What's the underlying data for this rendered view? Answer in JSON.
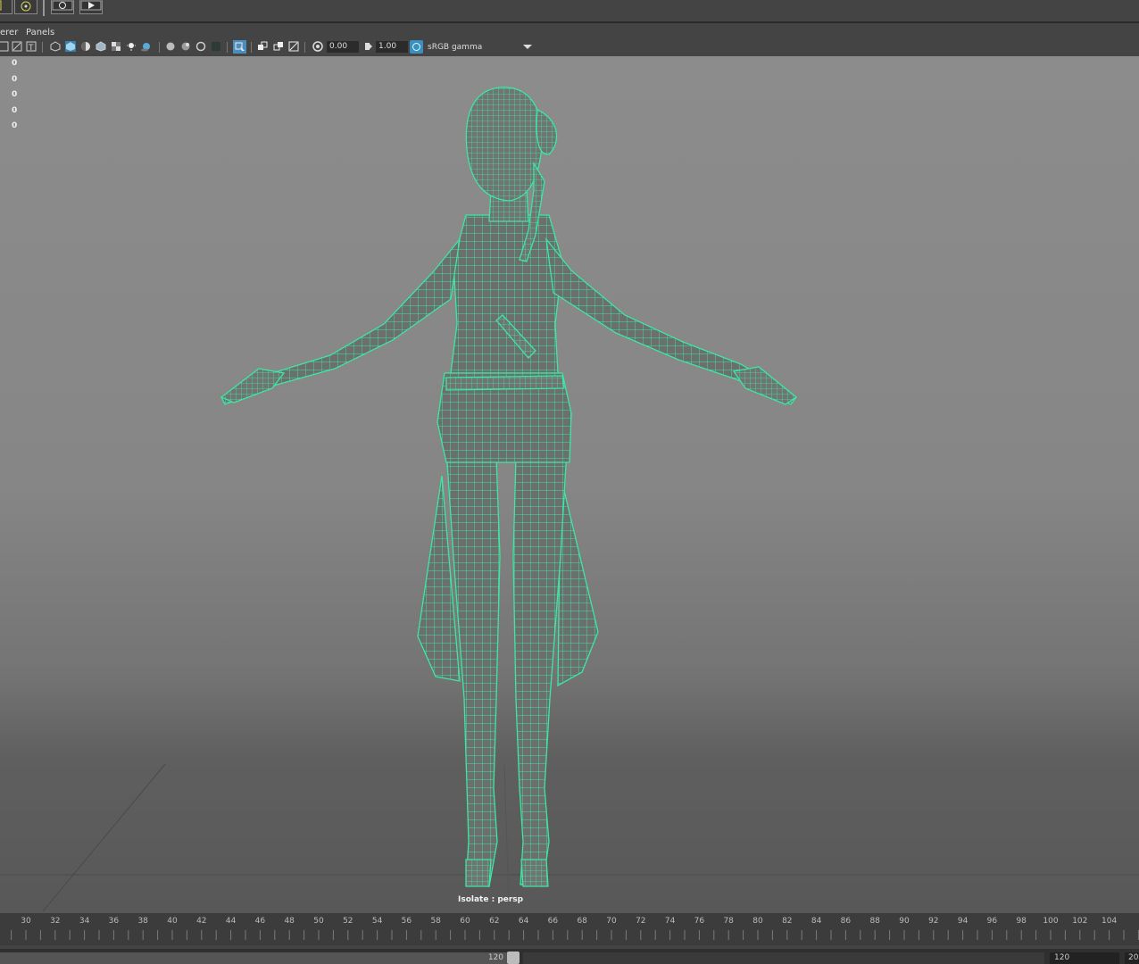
{
  "menu": {
    "renderer_partial": "erer",
    "panels": "Panels"
  },
  "toolbar": {
    "exposure_value": "0.00",
    "gamma_value": "1.00",
    "color_space": "sRGB gamma"
  },
  "hud": {
    "lines": [
      "0",
      "0",
      "0",
      "0",
      "0"
    ]
  },
  "viewport": {
    "isolate_label": "Isolate : persp",
    "wireframe_color": "#3ee6a4",
    "mesh_fill_color": "#6a6e6c"
  },
  "timeline": {
    "ticks": [
      "30",
      "32",
      "34",
      "36",
      "38",
      "40",
      "42",
      "44",
      "46",
      "48",
      "50",
      "52",
      "54",
      "56",
      "58",
      "60",
      "62",
      "64",
      "66",
      "68",
      "70",
      "72",
      "74",
      "76",
      "78",
      "80",
      "82",
      "84",
      "86",
      "88",
      "90",
      "92",
      "94",
      "96",
      "98",
      "100",
      "102",
      "104"
    ]
  },
  "range": {
    "end_value": "120",
    "playback_end": "120",
    "partial_right": "20"
  },
  "icons": [
    "shelf-render-icon",
    "shelf-ipr-icon",
    "camera-icon",
    "wireframe-icon",
    "smooth-shade-icon",
    "light-icon",
    "isolate-icon",
    "exposure-icon",
    "gamma-icon",
    "color-space-icon",
    "dropdown-arrow-icon"
  ]
}
